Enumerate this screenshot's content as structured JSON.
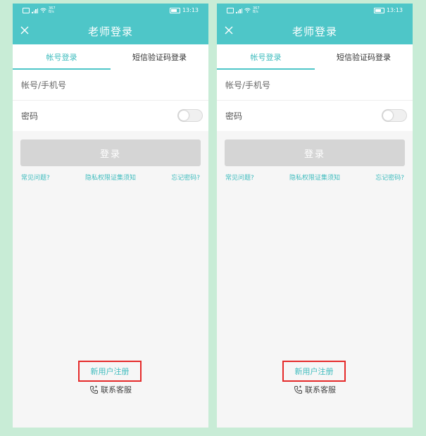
{
  "status_bar": {
    "network": "367",
    "network_unit": "B/s",
    "time": "13:13"
  },
  "header": {
    "title": "老师登录"
  },
  "tabs": [
    {
      "label": "帐号登录",
      "active": true
    },
    {
      "label": "短信验证码登录",
      "active": false
    }
  ],
  "form": {
    "account": {
      "value": "",
      "placeholder": "帐号/手机号"
    },
    "password": {
      "label": "密码",
      "toggle_on": false
    }
  },
  "login_button": {
    "label": "登录"
  },
  "links": {
    "faq": "常见问题?",
    "privacy": "隐私权限证集须知",
    "forgot": "忘记密码?"
  },
  "register": {
    "label": "新用户注册"
  },
  "contact": {
    "label": "联系客服"
  },
  "colors": {
    "accent": "#4ec6c8",
    "highlight_border": "#e52a2a",
    "background": "#c8ecd6",
    "disabled_button": "#d5d5d5"
  }
}
